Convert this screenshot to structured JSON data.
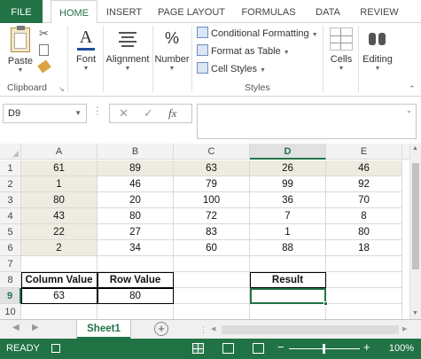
{
  "ribbon_tabs": [
    "FILE",
    "HOME",
    "INSERT",
    "PAGE LAYOUT",
    "FORMULAS",
    "DATA",
    "REVIEW"
  ],
  "ribbon": {
    "paste_label": "Paste",
    "font_label": "Font",
    "alignment_label": "Alignment",
    "number_label": "Number",
    "conditional_formatting": "Conditional Formatting",
    "format_as_table": "Format as Table",
    "cell_styles": "Cell Styles",
    "cells_label": "Cells",
    "editing_label": "Editing",
    "group_clipboard": "Clipboard",
    "group_styles": "Styles"
  },
  "formula_bar": {
    "name_box": "D9",
    "fx_label": "fx",
    "formula": ""
  },
  "grid": {
    "columns": [
      "A",
      "B",
      "C",
      "D",
      "E"
    ],
    "selected_column": "D",
    "rows": [
      "1",
      "2",
      "3",
      "4",
      "5",
      "6",
      "7",
      "8",
      "9",
      "10"
    ],
    "selected_row": "9",
    "data": [
      [
        "61",
        "89",
        "63",
        "26",
        "46"
      ],
      [
        "1",
        "46",
        "79",
        "99",
        "92"
      ],
      [
        "80",
        "20",
        "100",
        "36",
        "70"
      ],
      [
        "43",
        "80",
        "72",
        "7",
        "8"
      ],
      [
        "22",
        "27",
        "83",
        "1",
        "80"
      ],
      [
        "2",
        "34",
        "60",
        "88",
        "18"
      ]
    ],
    "column_value_header": "Column Value",
    "row_value_header": "Row Value",
    "result_header": "Result",
    "column_value": "63",
    "row_value": "80",
    "result_value": ""
  },
  "sheet_tabs": {
    "active": "Sheet1",
    "add_symbol": "+"
  },
  "status": {
    "text": "READY",
    "zoom": "100%"
  },
  "colors": {
    "accent": "#217346",
    "shaded_cell": "#eeece1"
  }
}
